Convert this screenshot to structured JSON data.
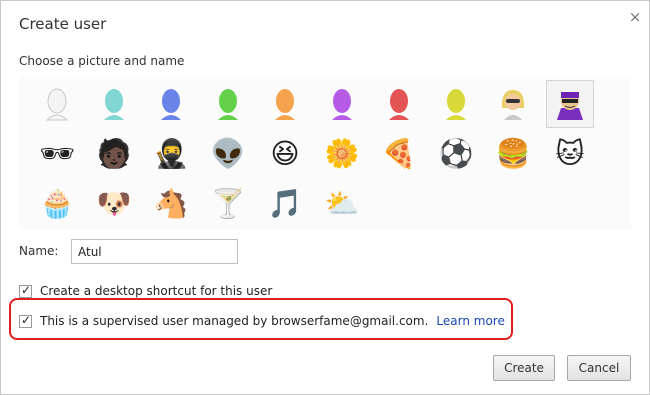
{
  "dialog": {
    "title": "Create user",
    "close_glyph": "×"
  },
  "picture_section": {
    "title": "Choose a picture and name"
  },
  "avatars": {
    "colored_heads": [
      {
        "name": "white",
        "color": "#f4f4f4"
      },
      {
        "name": "cyan",
        "color": "#7fd6d3"
      },
      {
        "name": "blue",
        "color": "#6a83e8"
      },
      {
        "name": "green",
        "color": "#63d24a"
      },
      {
        "name": "orange",
        "color": "#f4a24b"
      },
      {
        "name": "purple",
        "color": "#b65be6"
      },
      {
        "name": "red",
        "color": "#e45454"
      },
      {
        "name": "yellow",
        "color": "#d8d83a"
      }
    ],
    "emoji": [
      "🕶",
      "🧑🏿",
      "🥷",
      "👽",
      "😆",
      "🌼",
      "🍕",
      "⚽",
      "🍔",
      "🐱",
      "🧁",
      "🐶",
      "🐴",
      "🍸",
      "🎵",
      "⛅"
    ],
    "selected_index": 9
  },
  "name_field": {
    "label": "Name:",
    "value": "Atul"
  },
  "shortcut_checkbox": {
    "label": "Create a desktop shortcut for this user",
    "checked": true
  },
  "supervised_checkbox": {
    "label": "This is a supervised user managed by browserfame@gmail.com.",
    "link": "Learn more",
    "checked": true
  },
  "buttons": {
    "create": "Create",
    "cancel": "Cancel"
  },
  "colors": {
    "highlight": "#e02020",
    "link": "#1a47b8"
  }
}
